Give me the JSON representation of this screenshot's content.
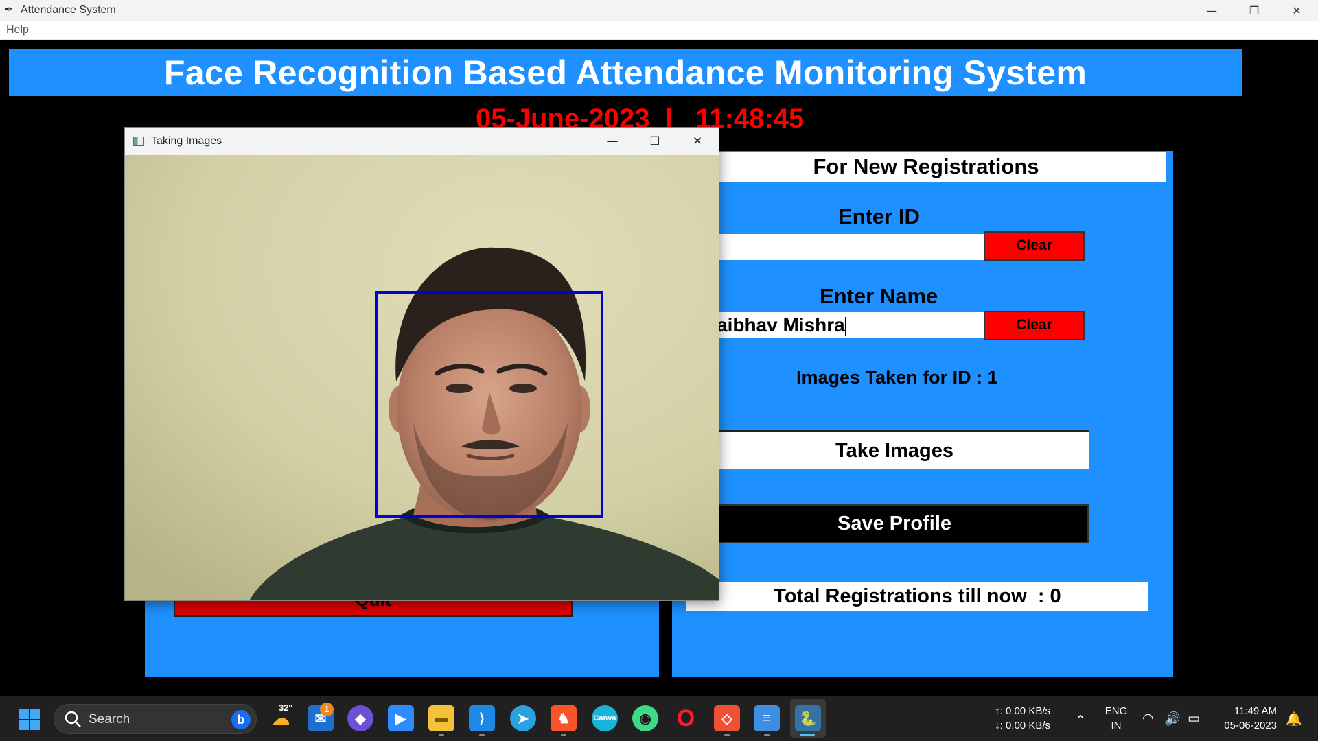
{
  "window": {
    "title": "Attendance System",
    "minimize_icon": "minimize-icon",
    "restore_icon": "restore-icon",
    "close_icon": "close-icon"
  },
  "menu": {
    "help": "Help"
  },
  "header": {
    "title": "Face Recognition Based Attendance Monitoring System",
    "datetime": "05-June-2023  |   11:48:45"
  },
  "left_panel": {
    "quit_label": "Quit"
  },
  "registration": {
    "title": "For New Registrations",
    "id_label": "Enter ID",
    "id_value": "",
    "name_label": "Enter Name",
    "name_value": "aibhav Mishra",
    "clear_label": "Clear",
    "status": "Images Taken for ID : 1",
    "take_images_label": "Take Images",
    "save_profile_label": "Save Profile",
    "total_label": "Total Registrations till now  : 0"
  },
  "camera_window": {
    "title": "Taking Images"
  },
  "taskbar": {
    "search_label": "Search",
    "weather_temp": "32°",
    "mail_badge": "1",
    "net_up": "↑: 0.00 KB/s",
    "net_down": "↓: 0.00 KB/s",
    "lang": "ENG",
    "region": "IN",
    "time": "11:49 AM",
    "date": "05-06-2023",
    "apps": [
      "weather",
      "mail",
      "copilot",
      "zoom",
      "file-explorer",
      "vscode",
      "telegram",
      "brave",
      "canva",
      "android-studio",
      "opera",
      "git",
      "notepad",
      "python"
    ]
  },
  "colors": {
    "accent": "#1e90ff",
    "danger": "#ff0000",
    "face_box": "#0000dd"
  }
}
